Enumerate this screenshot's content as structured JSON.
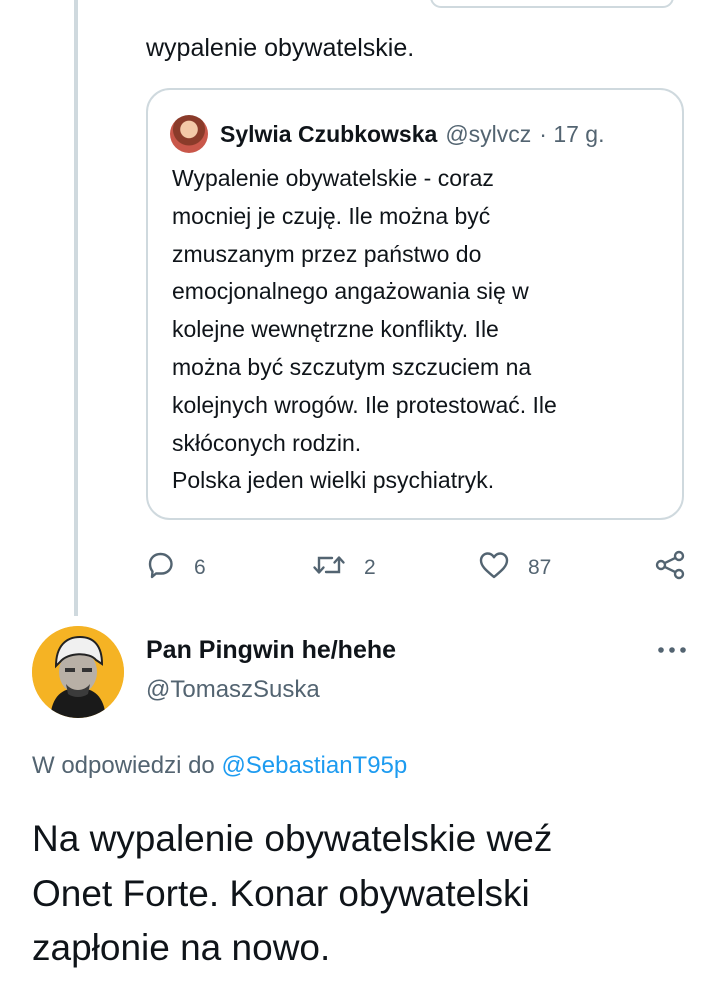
{
  "previous_tweet": {
    "text_tail": "wypalenie obywatelskie."
  },
  "quoted_tweet": {
    "author_name": "Sylwia Czubkowska",
    "author_handle": "@sylvcz",
    "time": "· 17 g.",
    "body": "Wypalenie obywatelskie - coraz\nmocniej je czuję. Ile można być\nzmuszanym przez państwo do\nemocjonalnego angażowania się w\nkolejne wewnętrzne konflikty. Ile\nmożna być szczutym szczuciem na\nkolejnych wrogów. Ile protestować. Ile\nskłóconych rodzin.\nPolska jeden wielki psychiatryk."
  },
  "actions": {
    "reply_count": "6",
    "retweet_count": "2",
    "like_count": "87",
    "icons": [
      "reply-icon",
      "retweet-icon",
      "like-icon",
      "share-icon"
    ]
  },
  "reply_tweet": {
    "author_name": "Pan Pingwin he/hehe",
    "author_handle": "@TomaszSuska",
    "reply_context_prefix": "W odpowiedzi do",
    "reply_context_mention": "@SebastianT95p",
    "body": "Na wypalenie obywatelskie weź\nOnet Forte. Konar obywatelski\nzapłonie na nowo."
  },
  "colors": {
    "text": "#0f1419",
    "secondary": "#536471",
    "accent": "#1d9bf0",
    "border": "#cfd9de",
    "avatar_bg": "#f5b324"
  }
}
